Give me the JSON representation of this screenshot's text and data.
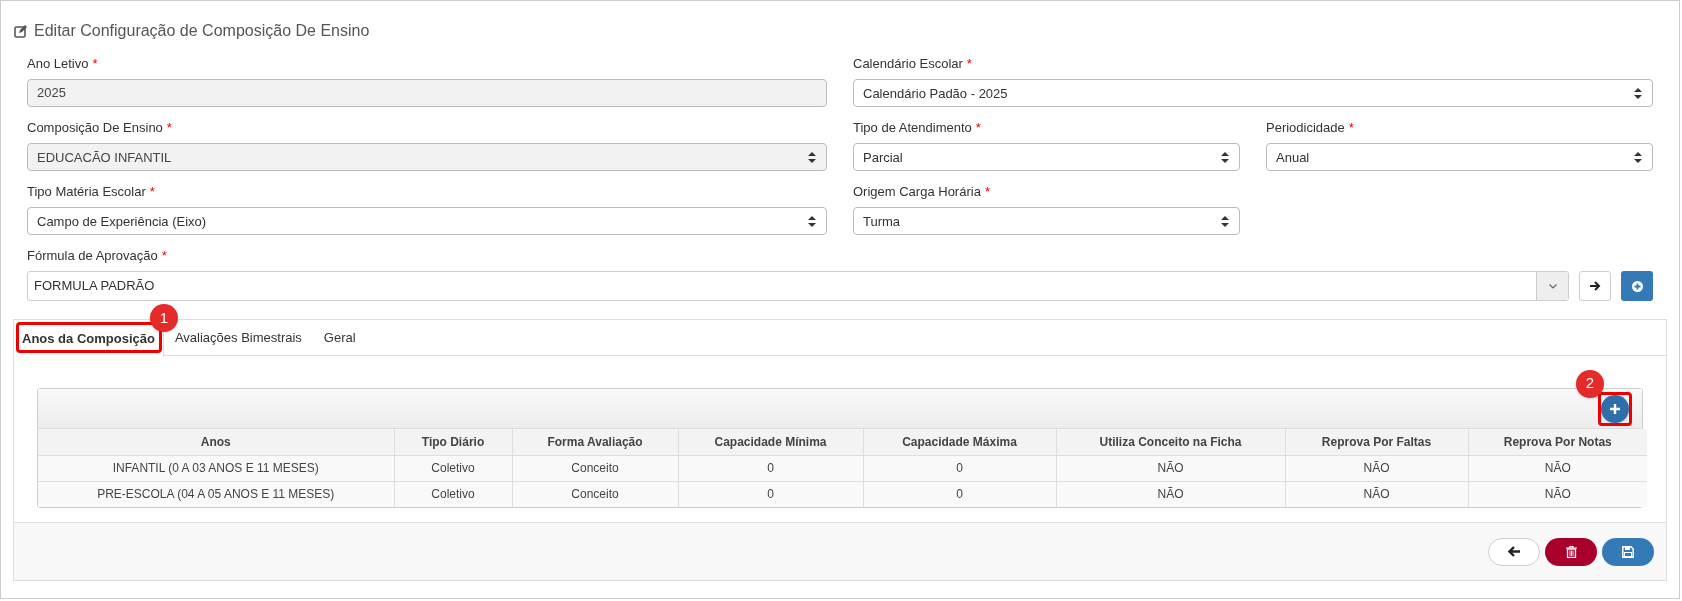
{
  "title": "Editar Configuração de Composição De Ensino",
  "form_rows": [
    [
      {
        "label": "Ano Letivo",
        "required_mark": "*",
        "kind": "text",
        "value": "2025",
        "disabled": true
      },
      {
        "label": "Calendário Escolar",
        "required_mark": "*",
        "kind": "select",
        "value": "Calendário Padão - 2025",
        "disabled": false
      }
    ],
    [
      {
        "label": "Composição De Ensino",
        "required_mark": "*",
        "kind": "select",
        "value": "EDUCACÃO INFANTIL",
        "disabled": true
      },
      {
        "label": "Tipo de Atendimento",
        "required_mark": "*",
        "kind": "select",
        "value": "Parcial",
        "disabled": false
      },
      {
        "label": "Periodicidade",
        "required_mark": "*",
        "kind": "select",
        "value": "Anual",
        "disabled": false
      }
    ],
    [
      {
        "label": "Tipo Matéria Escolar",
        "required_mark": "*",
        "kind": "select",
        "value": "Campo de Experiência (Eixo)",
        "disabled": false
      },
      {
        "label": "Origem Carga Horária",
        "required_mark": "*",
        "kind": "select",
        "value": "Turma",
        "disabled": false
      }
    ],
    [
      {
        "label": "Fórmula de Aprovação",
        "required_mark": "*",
        "kind": "combo",
        "value": "FORMULA PADRÃO",
        "disabled": false
      }
    ]
  ],
  "tabs": [
    {
      "label": "Anos da Composição",
      "selected": true,
      "callout": "1"
    },
    {
      "label": "Avaliações Bimestrais",
      "selected": false
    },
    {
      "label": "Geral",
      "selected": false
    }
  ],
  "table": {
    "add_button_callout": "2",
    "columns": [
      "Anos",
      "Tipo Diário",
      "Forma Avaliação",
      "Capacidade Mínima",
      "Capacidade Máxima",
      "Utiliza Conceito na Ficha",
      "Reprova Por Faltas",
      "Reprova Por Notas"
    ],
    "rows": [
      [
        "INFANTIL (0 A 03 ANOS E 11 MESES)",
        "Coletivo",
        "Conceito",
        "0",
        "0",
        "NÃO",
        "NÃO",
        "NÃO"
      ],
      [
        "PRE-ESCOLA (04 A 05 ANOS E 11 MESES)",
        "Coletivo",
        "Conceito",
        "0",
        "0",
        "NÃO",
        "NÃO",
        "NÃO"
      ]
    ]
  },
  "footer_buttons": [
    {
      "kind": "back"
    },
    {
      "kind": "delete"
    },
    {
      "kind": "save"
    }
  ]
}
